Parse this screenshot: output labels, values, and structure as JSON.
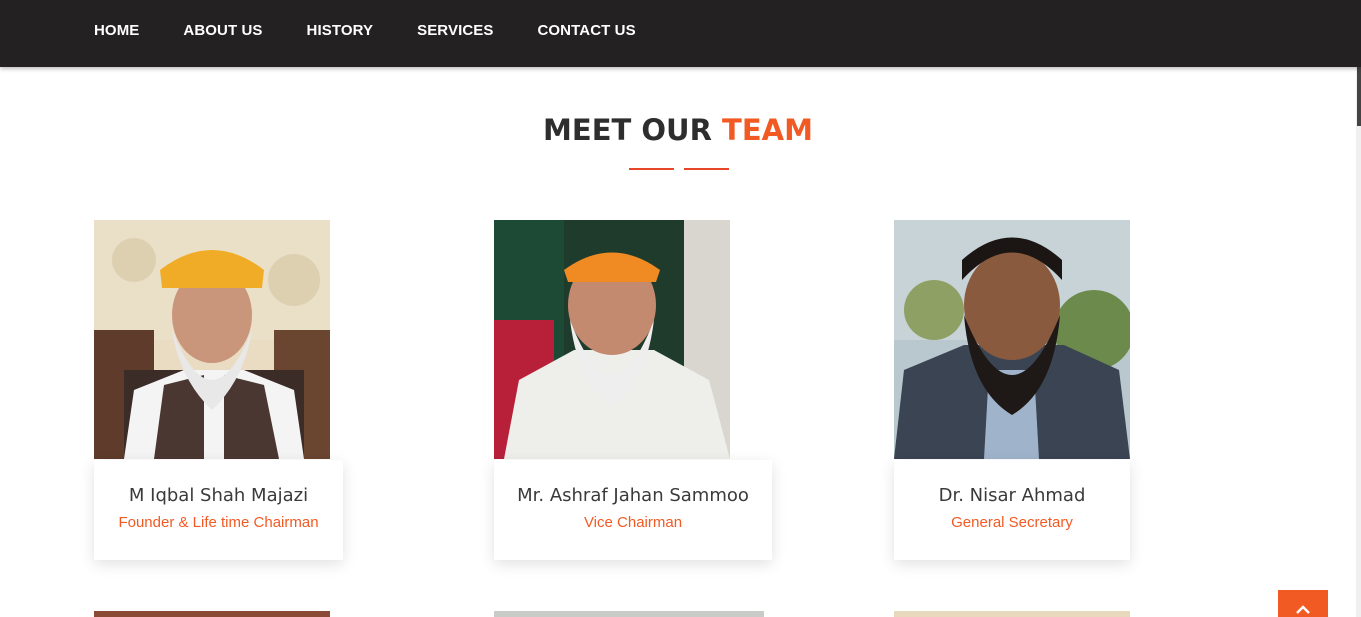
{
  "nav": {
    "items": [
      {
        "label": "HOME"
      },
      {
        "label": "ABOUT US"
      },
      {
        "label": "HISTORY"
      },
      {
        "label": "SERVICES"
      },
      {
        "label": "CONTACT US"
      }
    ]
  },
  "section": {
    "title_main": "MEET OUR",
    "title_accent": "TEAM"
  },
  "team": [
    {
      "name": "M Iqbal Shah Majazi",
      "role": "Founder & Life time Chairman"
    },
    {
      "name": "Mr. Ashraf Jahan Sammoo",
      "role": "Vice Chairman"
    },
    {
      "name": "Dr. Nisar Ahmad",
      "role": "General Secretary"
    }
  ],
  "icons": {
    "back_to_top": "chevron-up-icon"
  },
  "colors": {
    "navbar": "#232121",
    "accent": "#f25a24",
    "title": "#2e2e2e"
  }
}
